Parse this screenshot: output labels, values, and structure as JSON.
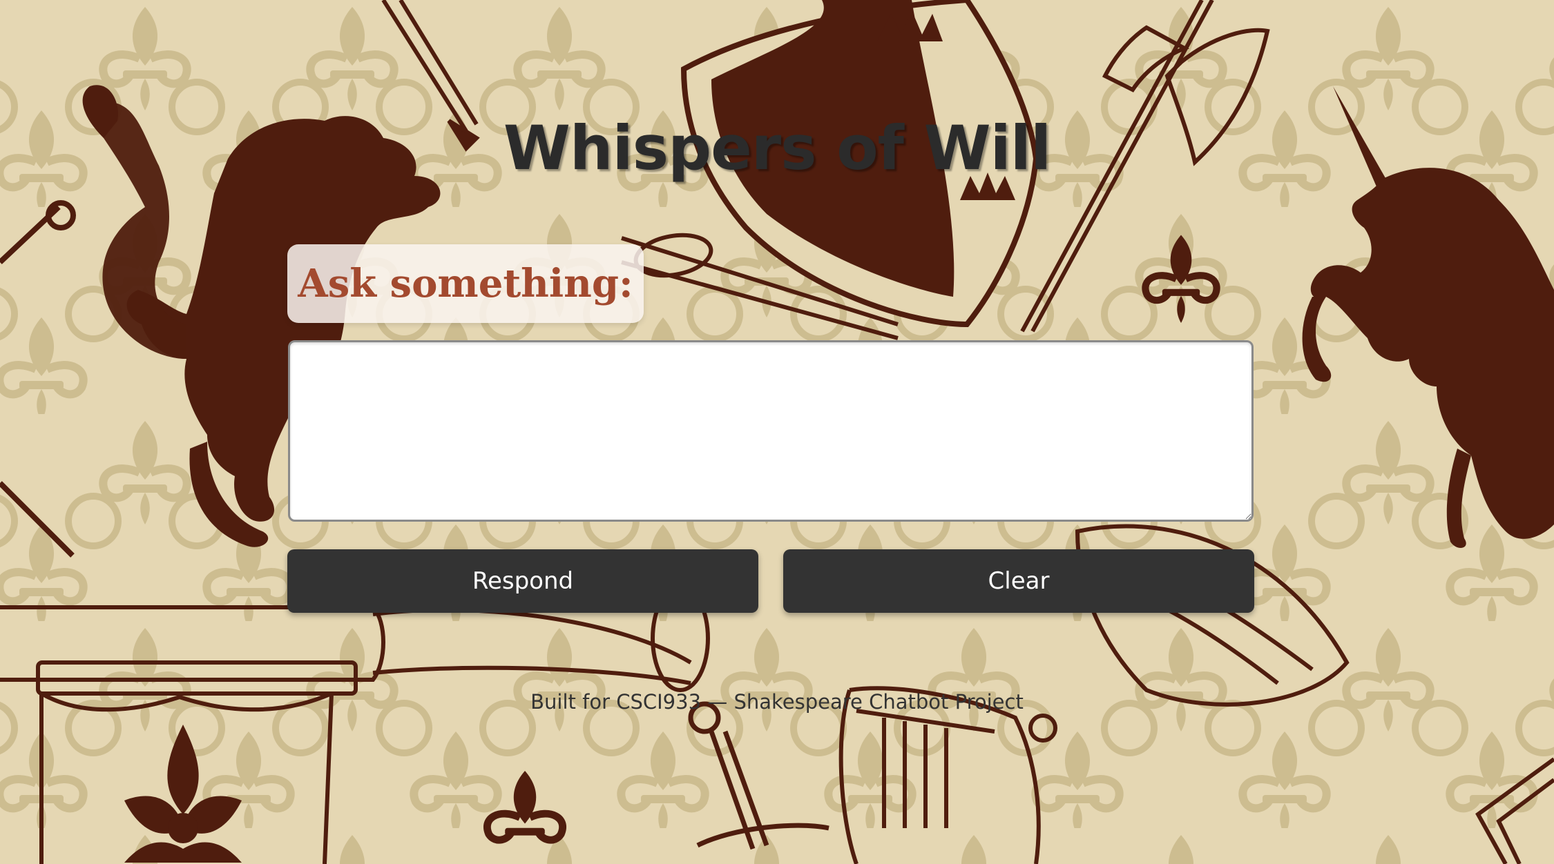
{
  "app": {
    "title": "Whispers of Will"
  },
  "form": {
    "prompt_label": "Ask something:",
    "question_value": "",
    "question_placeholder": ""
  },
  "buttons": {
    "respond_label": "Respond",
    "clear_label": "Clear"
  },
  "footer": {
    "text": "Built for CSCI933 — Shakespeare Chatbot Project"
  },
  "background": {
    "base_color": "#e5d7b3",
    "pattern_color": "#c9b88a",
    "ink_color": "#4f1d0e",
    "motifs": [
      "fleur-de-lis-icon",
      "rampant-lion-icon",
      "unicorn-icon",
      "heraldic-shield-icon",
      "battle-axe-icon",
      "knight-helmet-icon",
      "sword-icon",
      "banner-icon",
      "horn-icon"
    ]
  },
  "colors": {
    "title": "#2b2b2b",
    "label_text": "#a34a2f",
    "button_bg": "#333333",
    "button_text": "#ffffff"
  }
}
